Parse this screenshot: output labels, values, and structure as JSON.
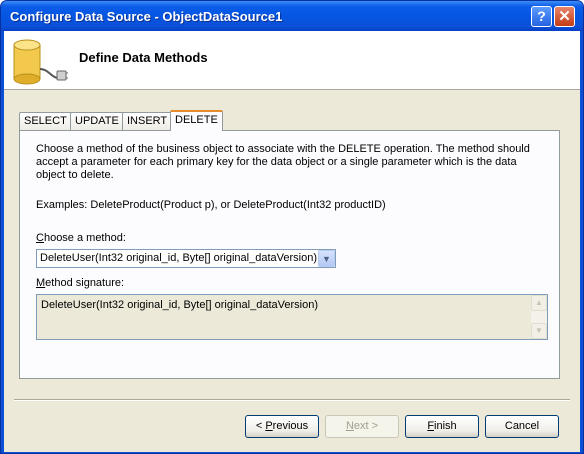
{
  "window": {
    "title": "Configure Data Source - ObjectDataSource1",
    "help_glyph": "?",
    "close_glyph": "✕"
  },
  "header": {
    "title": "Define Data Methods",
    "icon": "database-plug-icon"
  },
  "tabs": [
    {
      "label": "SELECT",
      "active": false
    },
    {
      "label": "UPDATE",
      "active": false
    },
    {
      "label": "INSERT",
      "active": false
    },
    {
      "label": "DELETE",
      "active": true
    }
  ],
  "panel": {
    "description": "Choose a method of the business object to associate with the DELETE operation. The method should accept a parameter for each primary key for the data object or a single parameter which is the data object to delete.",
    "examples": "Examples: DeleteProduct(Product p), or DeleteProduct(Int32 productID)",
    "choose_label_first": "C",
    "choose_label_rest": "hoose a method:",
    "method_selected": "DeleteUser(Int32 original_id, Byte[] original_dataVersion)",
    "signature_label_first": "M",
    "signature_label_rest": "ethod signature:",
    "signature": "DeleteUser(Int32 original_id, Byte[] original_dataVersion)"
  },
  "buttons": {
    "previous_pre": "< ",
    "previous_key": "P",
    "previous_rest": "revious",
    "next_key": "N",
    "next_rest": "ext >",
    "finish_key": "F",
    "finish_rest": "inish",
    "cancel": "Cancel"
  }
}
